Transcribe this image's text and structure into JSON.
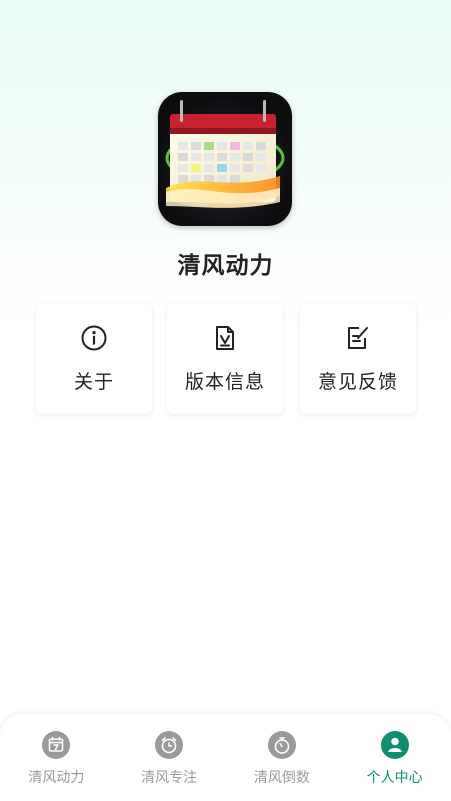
{
  "app": {
    "name": "清风动力"
  },
  "cards": [
    {
      "label": "关于",
      "icon": "info-icon"
    },
    {
      "label": "版本信息",
      "icon": "version-document-icon"
    },
    {
      "label": "意见反馈",
      "icon": "feedback-edit-icon"
    }
  ],
  "tabbar": {
    "items": [
      {
        "label": "清风动力",
        "icon": "calendar-icon",
        "active": false
      },
      {
        "label": "清风专注",
        "icon": "alarm-clock-icon",
        "active": false
      },
      {
        "label": "清风倒数",
        "icon": "stopwatch-icon",
        "active": false
      },
      {
        "label": "个人中心",
        "icon": "user-icon",
        "active": true
      }
    ]
  },
  "colors": {
    "accent": "#0f8f70",
    "inactive": "#9a9a9a",
    "text": "#222222"
  }
}
